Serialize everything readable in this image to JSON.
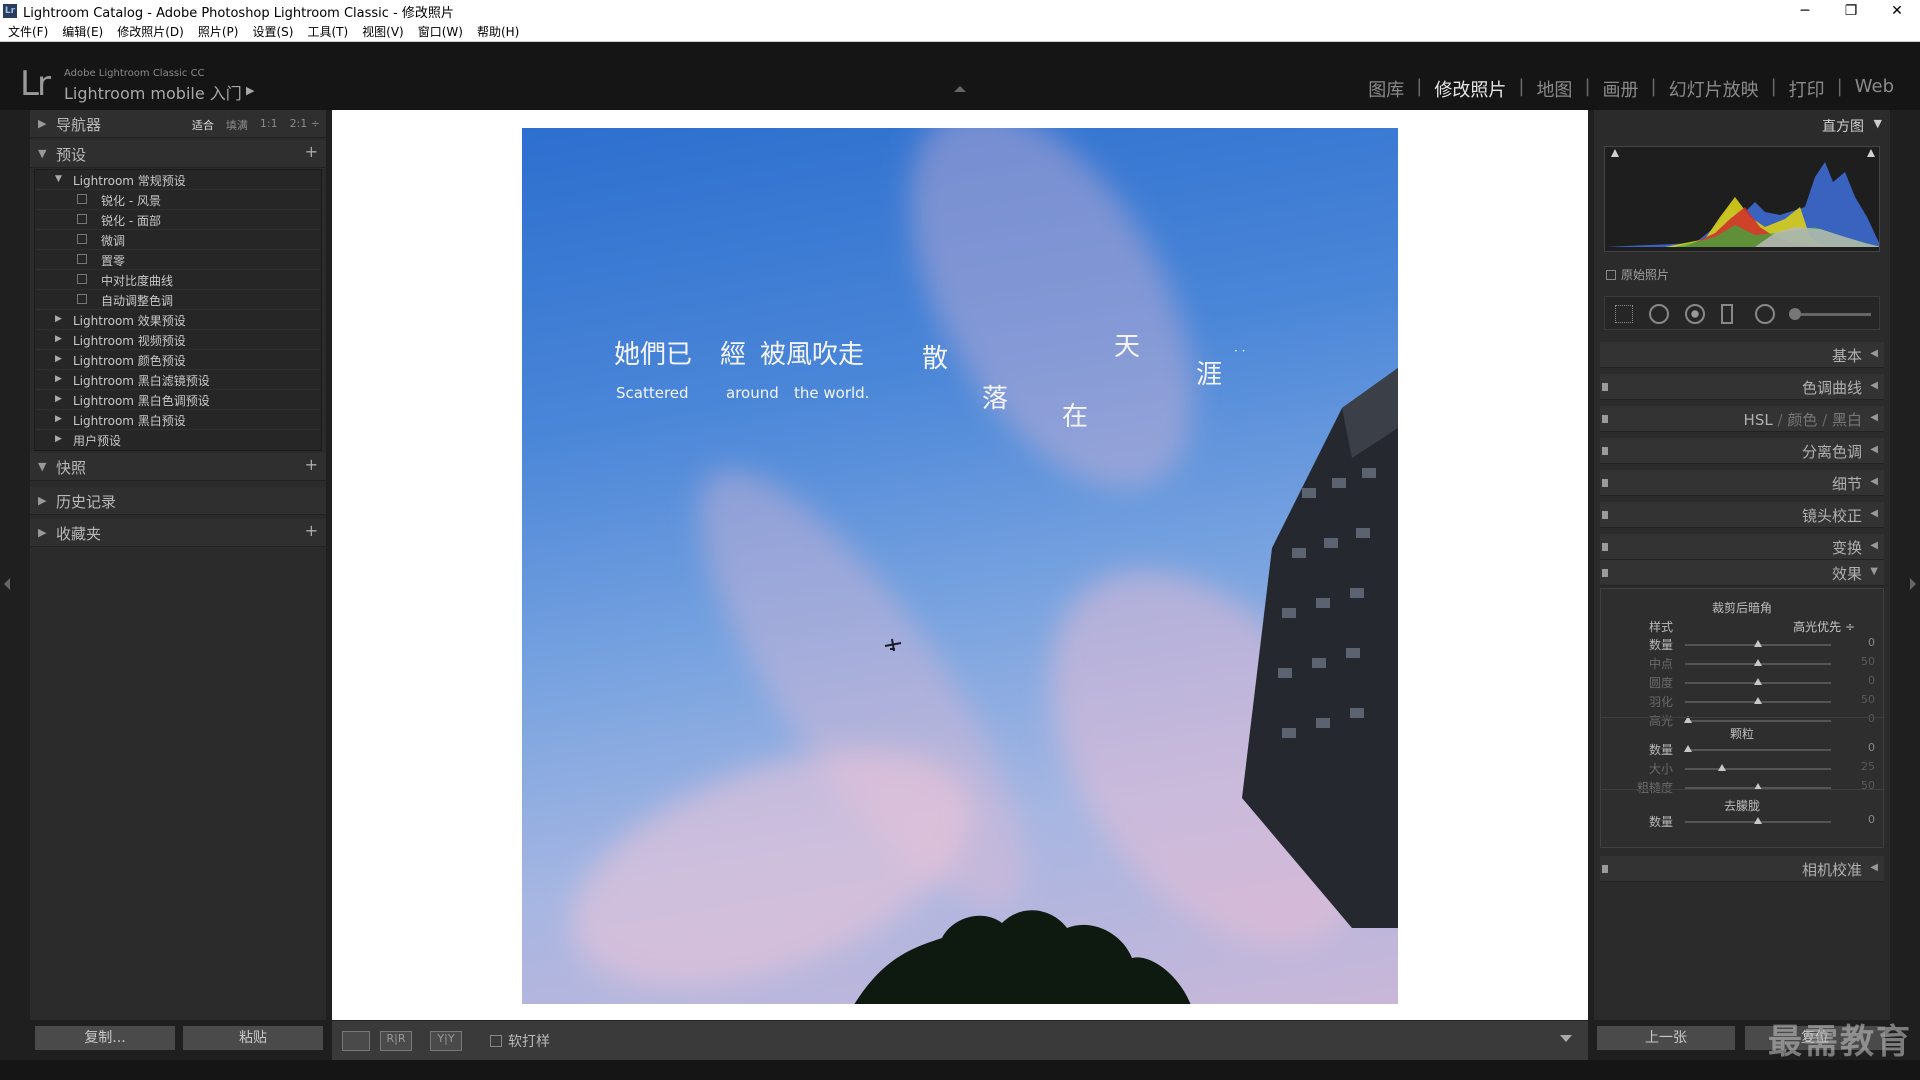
{
  "window": {
    "title": "Lightroom Catalog - Adobe Photoshop Lightroom Classic - 修改照片",
    "app_icon": "Lr",
    "controls": [
      "─",
      "❐",
      "✕"
    ]
  },
  "menu": [
    "文件(F)",
    "编辑(E)",
    "修改照片(D)",
    "照片(P)",
    "设置(S)",
    "工具(T)",
    "视图(V)",
    "窗口(W)",
    "帮助(H)"
  ],
  "identity": {
    "logo": "Lr",
    "small": "Adobe Lightroom Classic CC",
    "main": "Lightroom mobile 入门",
    "arrow": "▶"
  },
  "modules": [
    "图库",
    "修改照片",
    "地图",
    "画册",
    "幻灯片放映",
    "打印",
    "Web"
  ],
  "module_separator": "|",
  "active_module": "修改照片",
  "left_panel": {
    "navigator": {
      "title": "导航器",
      "zoom": [
        "适合",
        "填满",
        "1:1",
        "2:1 ÷"
      ],
      "zoom_active": "适合"
    },
    "presets": {
      "title": "预设",
      "groups": [
        {
          "label": "Lightroom 常规预设",
          "open": true,
          "items": [
            "锐化 - 风景",
            "锐化 - 面部",
            "微调",
            "置零",
            "中对比度曲线",
            "自动调整色调"
          ]
        },
        {
          "label": "Lightroom 效果预设"
        },
        {
          "label": "Lightroom 视频预设"
        },
        {
          "label": "Lightroom 颜色预设"
        },
        {
          "label": "Lightroom 黑白滤镜预设"
        },
        {
          "label": "Lightroom 黑白色调预设"
        },
        {
          "label": "Lightroom 黑白预设"
        },
        {
          "label": "用户预设"
        }
      ]
    },
    "snapshots": "快照",
    "history": "历史记录",
    "collections": "收藏夹",
    "copy_btn": "复制...",
    "paste_btn": "粘贴"
  },
  "photo_text": {
    "line1": [
      "她們已",
      "經",
      "被風吹走"
    ],
    "english": [
      "Scattered",
      "around",
      "the world."
    ],
    "diagonal": [
      "散",
      "落",
      "在",
      "天",
      "涯"
    ],
    "dots": "· ·"
  },
  "toolbar": {
    "soft_proof": "软打样",
    "rr": "R|R",
    "yy": "Y|Y"
  },
  "right_panel": {
    "histogram_title": "直方图",
    "original_photo": "原始照片",
    "panels": [
      {
        "label": "基本",
        "open": false
      },
      {
        "label": "色调曲线",
        "open": false
      },
      {
        "label": "HSL / 颜色 / 黑白",
        "open": false
      },
      {
        "label": "分离色调",
        "open": false
      },
      {
        "label": "细节",
        "open": false
      },
      {
        "label": "镜头校正",
        "open": false
      },
      {
        "label": "变换",
        "open": false
      },
      {
        "label": "效果",
        "open": true
      }
    ],
    "hsl_parts": [
      "HSL",
      "/",
      "颜色",
      "/",
      "黑白"
    ],
    "effects": {
      "vignette_title": "裁剪后暗角",
      "style_label": "样式",
      "style_value": "高光优先 ÷",
      "vignette": [
        {
          "label": "数量",
          "value": "0",
          "pos": 0.5,
          "dim": false
        },
        {
          "label": "中点",
          "value": "50",
          "pos": 0.5,
          "dim": true
        },
        {
          "label": "圆度",
          "value": "0",
          "pos": 0.5,
          "dim": true
        },
        {
          "label": "羽化",
          "value": "50",
          "pos": 0.5,
          "dim": true
        },
        {
          "label": "高光",
          "value": "0",
          "pos": 0.02,
          "dim": true
        }
      ],
      "grain_title": "颗粒",
      "grain": [
        {
          "label": "数量",
          "value": "0",
          "pos": 0.02,
          "dim": false
        },
        {
          "label": "大小",
          "value": "25",
          "pos": 0.25,
          "dim": true
        },
        {
          "label": "粗糙度",
          "value": "50",
          "pos": 0.5,
          "dim": true
        }
      ],
      "dehaze_title": "去朦胧",
      "dehaze": [
        {
          "label": "数量",
          "value": "0",
          "pos": 0.5,
          "dim": false
        }
      ]
    },
    "camera_calibration": "相机校准",
    "prev_btn": "上一张",
    "reset_btn": "复位"
  },
  "watermark": "最需教育",
  "colors": {
    "accent": "#e6e6e6",
    "panel": "#2b2b2b",
    "frame": "#ffffff"
  }
}
